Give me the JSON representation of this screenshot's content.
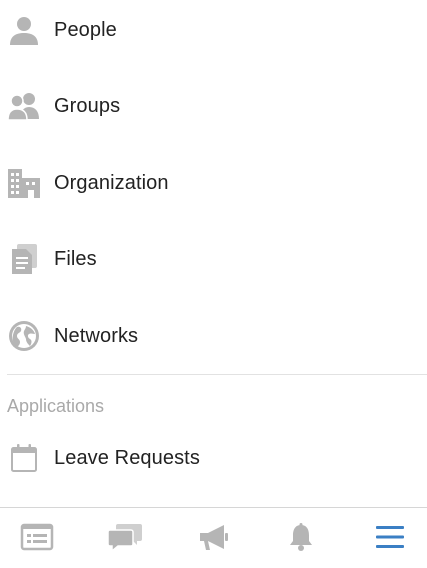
{
  "menu": {
    "items": [
      {
        "label": "People",
        "icon": "person-icon"
      },
      {
        "label": "Groups",
        "icon": "group-icon"
      },
      {
        "label": "Organization",
        "icon": "building-icon"
      },
      {
        "label": "Files",
        "icon": "file-icon"
      },
      {
        "label": "Networks",
        "icon": "globe-icon"
      }
    ]
  },
  "applications": {
    "header": "Applications",
    "items": [
      {
        "label": "Leave Requests",
        "icon": "calendar-icon"
      }
    ]
  },
  "tabbar": {
    "tabs": [
      {
        "icon": "feed-icon",
        "active": false
      },
      {
        "icon": "chat-icon",
        "active": false
      },
      {
        "icon": "megaphone-icon",
        "active": false
      },
      {
        "icon": "bell-icon",
        "active": false
      },
      {
        "icon": "hamburger-menu-icon",
        "active": true
      }
    ]
  },
  "colors": {
    "icon_gray": "#b5b5b5",
    "active_blue": "#3b7fc4",
    "section_gray": "#a9a9a9"
  }
}
